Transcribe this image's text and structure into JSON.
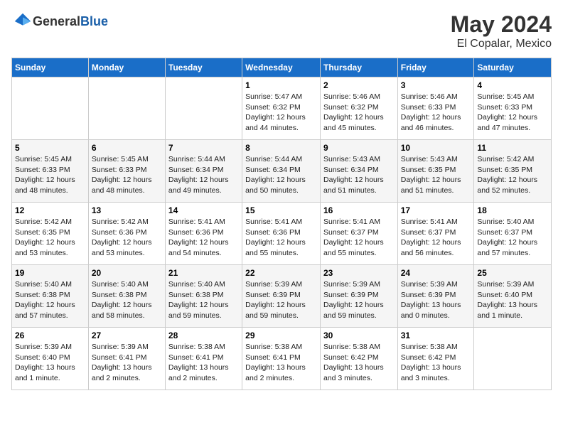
{
  "header": {
    "logo_general": "General",
    "logo_blue": "Blue",
    "title": "May 2024",
    "location": "El Copalar, Mexico"
  },
  "weekdays": [
    "Sunday",
    "Monday",
    "Tuesday",
    "Wednesday",
    "Thursday",
    "Friday",
    "Saturday"
  ],
  "weeks": [
    [
      {
        "day": "",
        "info": ""
      },
      {
        "day": "",
        "info": ""
      },
      {
        "day": "",
        "info": ""
      },
      {
        "day": "1",
        "info": "Sunrise: 5:47 AM\nSunset: 6:32 PM\nDaylight: 12 hours\nand 44 minutes."
      },
      {
        "day": "2",
        "info": "Sunrise: 5:46 AM\nSunset: 6:32 PM\nDaylight: 12 hours\nand 45 minutes."
      },
      {
        "day": "3",
        "info": "Sunrise: 5:46 AM\nSunset: 6:33 PM\nDaylight: 12 hours\nand 46 minutes."
      },
      {
        "day": "4",
        "info": "Sunrise: 5:45 AM\nSunset: 6:33 PM\nDaylight: 12 hours\nand 47 minutes."
      }
    ],
    [
      {
        "day": "5",
        "info": "Sunrise: 5:45 AM\nSunset: 6:33 PM\nDaylight: 12 hours\nand 48 minutes."
      },
      {
        "day": "6",
        "info": "Sunrise: 5:45 AM\nSunset: 6:33 PM\nDaylight: 12 hours\nand 48 minutes."
      },
      {
        "day": "7",
        "info": "Sunrise: 5:44 AM\nSunset: 6:34 PM\nDaylight: 12 hours\nand 49 minutes."
      },
      {
        "day": "8",
        "info": "Sunrise: 5:44 AM\nSunset: 6:34 PM\nDaylight: 12 hours\nand 50 minutes."
      },
      {
        "day": "9",
        "info": "Sunrise: 5:43 AM\nSunset: 6:34 PM\nDaylight: 12 hours\nand 51 minutes."
      },
      {
        "day": "10",
        "info": "Sunrise: 5:43 AM\nSunset: 6:35 PM\nDaylight: 12 hours\nand 51 minutes."
      },
      {
        "day": "11",
        "info": "Sunrise: 5:42 AM\nSunset: 6:35 PM\nDaylight: 12 hours\nand 52 minutes."
      }
    ],
    [
      {
        "day": "12",
        "info": "Sunrise: 5:42 AM\nSunset: 6:35 PM\nDaylight: 12 hours\nand 53 minutes."
      },
      {
        "day": "13",
        "info": "Sunrise: 5:42 AM\nSunset: 6:36 PM\nDaylight: 12 hours\nand 53 minutes."
      },
      {
        "day": "14",
        "info": "Sunrise: 5:41 AM\nSunset: 6:36 PM\nDaylight: 12 hours\nand 54 minutes."
      },
      {
        "day": "15",
        "info": "Sunrise: 5:41 AM\nSunset: 6:36 PM\nDaylight: 12 hours\nand 55 minutes."
      },
      {
        "day": "16",
        "info": "Sunrise: 5:41 AM\nSunset: 6:37 PM\nDaylight: 12 hours\nand 55 minutes."
      },
      {
        "day": "17",
        "info": "Sunrise: 5:41 AM\nSunset: 6:37 PM\nDaylight: 12 hours\nand 56 minutes."
      },
      {
        "day": "18",
        "info": "Sunrise: 5:40 AM\nSunset: 6:37 PM\nDaylight: 12 hours\nand 57 minutes."
      }
    ],
    [
      {
        "day": "19",
        "info": "Sunrise: 5:40 AM\nSunset: 6:38 PM\nDaylight: 12 hours\nand 57 minutes."
      },
      {
        "day": "20",
        "info": "Sunrise: 5:40 AM\nSunset: 6:38 PM\nDaylight: 12 hours\nand 58 minutes."
      },
      {
        "day": "21",
        "info": "Sunrise: 5:40 AM\nSunset: 6:38 PM\nDaylight: 12 hours\nand 59 minutes."
      },
      {
        "day": "22",
        "info": "Sunrise: 5:39 AM\nSunset: 6:39 PM\nDaylight: 12 hours\nand 59 minutes."
      },
      {
        "day": "23",
        "info": "Sunrise: 5:39 AM\nSunset: 6:39 PM\nDaylight: 12 hours\nand 59 minutes."
      },
      {
        "day": "24",
        "info": "Sunrise: 5:39 AM\nSunset: 6:39 PM\nDaylight: 13 hours\nand 0 minutes."
      },
      {
        "day": "25",
        "info": "Sunrise: 5:39 AM\nSunset: 6:40 PM\nDaylight: 13 hours\nand 1 minute."
      }
    ],
    [
      {
        "day": "26",
        "info": "Sunrise: 5:39 AM\nSunset: 6:40 PM\nDaylight: 13 hours\nand 1 minute."
      },
      {
        "day": "27",
        "info": "Sunrise: 5:39 AM\nSunset: 6:41 PM\nDaylight: 13 hours\nand 2 minutes."
      },
      {
        "day": "28",
        "info": "Sunrise: 5:38 AM\nSunset: 6:41 PM\nDaylight: 13 hours\nand 2 minutes."
      },
      {
        "day": "29",
        "info": "Sunrise: 5:38 AM\nSunset: 6:41 PM\nDaylight: 13 hours\nand 2 minutes."
      },
      {
        "day": "30",
        "info": "Sunrise: 5:38 AM\nSunset: 6:42 PM\nDaylight: 13 hours\nand 3 minutes."
      },
      {
        "day": "31",
        "info": "Sunrise: 5:38 AM\nSunset: 6:42 PM\nDaylight: 13 hours\nand 3 minutes."
      },
      {
        "day": "",
        "info": ""
      }
    ]
  ]
}
